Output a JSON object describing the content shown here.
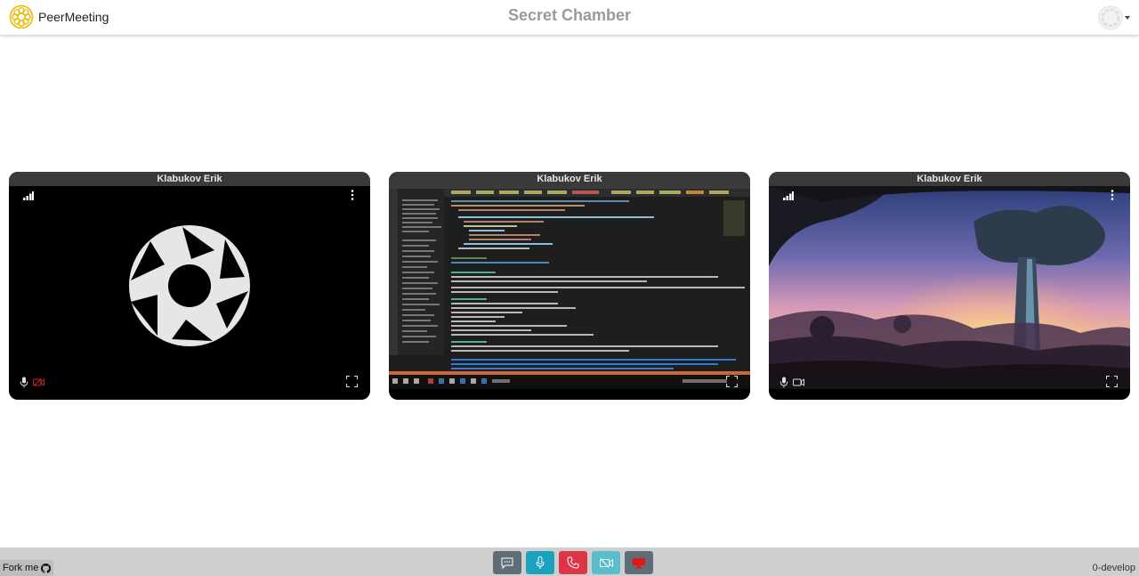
{
  "header": {
    "brand_name": "PeerMeeting",
    "room_title": "Secret Chamber"
  },
  "participants": [
    {
      "name": "Klabukov Erik",
      "content": "camera-off-placeholder",
      "mic": "on",
      "camera": "off"
    },
    {
      "name": "Klabukov Erik",
      "content": "screen-share",
      "mic": "on",
      "camera": "on"
    },
    {
      "name": "Klabukov Erik",
      "content": "camera-video",
      "mic": "on",
      "camera": "on"
    }
  ],
  "footer": {
    "fork_label": "Fork me",
    "version": "0-develop",
    "controls": [
      {
        "icon": "chat-icon",
        "color": "#5f6d79"
      },
      {
        "icon": "microphone-icon",
        "color": "#1aa3be"
      },
      {
        "icon": "phone-hangup-icon",
        "color": "#dc3545"
      },
      {
        "icon": "video-off-icon",
        "color": "#5bbccd"
      },
      {
        "icon": "screen-share-icon",
        "color": "#5f6d79"
      }
    ]
  },
  "colors": {
    "brand_yellow": "#e6b800",
    "camera_off_red": "#d22222",
    "tile_header": "#3a3a3a",
    "footer_bg": "#cfcfcf"
  }
}
